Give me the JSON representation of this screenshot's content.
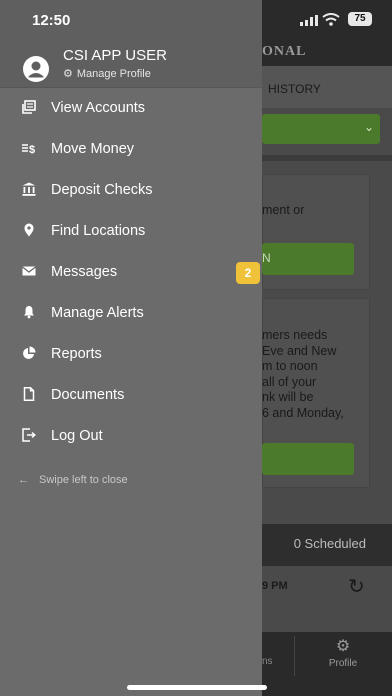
{
  "status_bar": {
    "time": "12:50",
    "battery": "75"
  },
  "background": {
    "brand_fragment": "ONAL",
    "tab_history": "HISTORY",
    "card1_text": "ment or",
    "card1_button": "N",
    "card2_text": "mers needs\nEve and New\nm to noon\nall of your\nnk will be\n6 and Monday,",
    "scheduled": "0 Scheduled",
    "time_fragment": "9 PM",
    "nav_left_fragment": "ns",
    "nav_profile": "Profile"
  },
  "drawer": {
    "user_name": "CSI APP USER",
    "manage_profile": "Manage Profile",
    "items": [
      {
        "label": "View Accounts",
        "icon": "accounts-icon"
      },
      {
        "label": "Move Money",
        "icon": "transfer-icon"
      },
      {
        "label": "Deposit Checks",
        "icon": "bank-icon"
      },
      {
        "label": "Find Locations",
        "icon": "location-pin-icon"
      },
      {
        "label": "Messages",
        "icon": "envelope-icon",
        "badge": "2"
      },
      {
        "label": "Manage Alerts",
        "icon": "bell-icon"
      },
      {
        "label": "Reports",
        "icon": "pie-chart-icon"
      },
      {
        "label": "Documents",
        "icon": "document-icon"
      },
      {
        "label": "Log Out",
        "icon": "logout-icon"
      }
    ],
    "swipe_hint": "Swipe left to close"
  },
  "colors": {
    "accent_green": "#4b7a2b",
    "badge_yellow": "#f0c23a",
    "drawer_bg": "#6b6b6b"
  }
}
